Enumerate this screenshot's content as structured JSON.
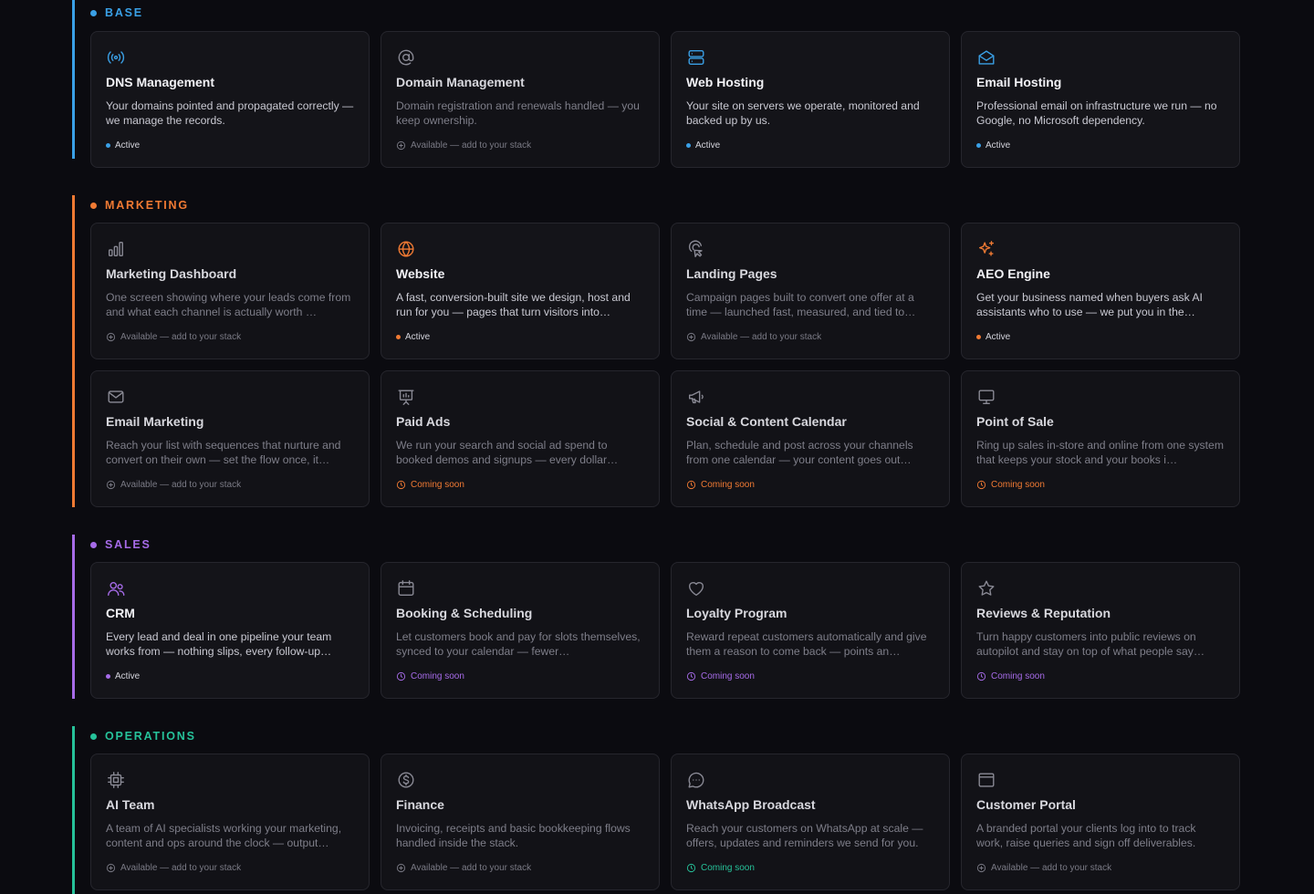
{
  "colors": {
    "base": "#3aa0e6",
    "marketing": "#f07a33",
    "sales": "#a66be8",
    "operations": "#26c29a",
    "icon_muted": "#8a8a95"
  },
  "sections": [
    {
      "key": "base",
      "title": "BASE",
      "cards": [
        {
          "icon": "broadcast-icon",
          "title": "DNS Management",
          "desc": "Your domains pointed and propagated correctly — we manage the records.",
          "status": "active",
          "status_label": "Active"
        },
        {
          "icon": "at-sign-icon",
          "title": "Domain Management",
          "desc": "Domain registration and renewals handled — you keep ownership.",
          "status": "available",
          "status_label": "Available — add to your stack"
        },
        {
          "icon": "server-icon",
          "title": "Web Hosting",
          "desc": "Your site on servers we operate, monitored and backed up by us.",
          "status": "active",
          "status_label": "Active"
        },
        {
          "icon": "mail-open-icon",
          "title": "Email Hosting",
          "desc": "Professional email on infrastructure we run — no Google, no Microsoft dependency.",
          "status": "active",
          "status_label": "Active"
        }
      ]
    },
    {
      "key": "marketing",
      "title": "MARKETING",
      "cards": [
        {
          "icon": "bar-chart-icon",
          "title": "Marketing Dashboard",
          "desc": "One screen showing where your leads come from and what each channel is actually worth …",
          "status": "available",
          "status_label": "Available — add to your stack"
        },
        {
          "icon": "globe-icon",
          "title": "Website",
          "desc": "A fast, conversion-built site we design, host and run for you — pages that turn visitors into…",
          "status": "active",
          "status_label": "Active"
        },
        {
          "icon": "pointer-icon",
          "title": "Landing Pages",
          "desc": "Campaign pages built to convert one offer at a time — launched fast, measured, and tied to…",
          "status": "available",
          "status_label": "Available — add to your stack"
        },
        {
          "icon": "sparkles-icon",
          "title": "AEO Engine",
          "desc": "Get your business named when buyers ask AI assistants who to use — we put you in the…",
          "status": "active",
          "status_label": "Active"
        },
        {
          "icon": "mail-icon",
          "title": "Email Marketing",
          "desc": "Reach your list with sequences that nurture and convert on their own — set the flow once, it…",
          "status": "available",
          "status_label": "Available — add to your stack"
        },
        {
          "icon": "presentation-icon",
          "title": "Paid Ads",
          "desc": "We run your search and social ad spend to booked demos and signups — every dollar…",
          "status": "soon",
          "status_label": "Coming soon"
        },
        {
          "icon": "megaphone-icon",
          "title": "Social & Content Calendar",
          "desc": "Plan, schedule and post across your channels from one calendar — your content goes out…",
          "status": "soon",
          "status_label": "Coming soon"
        },
        {
          "icon": "monitor-icon",
          "title": "Point of Sale",
          "desc": "Ring up sales in-store and online from one system that keeps your stock and your books i…",
          "status": "soon",
          "status_label": "Coming soon"
        }
      ]
    },
    {
      "key": "sales",
      "title": "SALES",
      "cards": [
        {
          "icon": "users-icon",
          "title": "CRM",
          "desc": "Every lead and deal in one pipeline your team works from — nothing slips, every follow-up…",
          "status": "active",
          "status_label": "Active"
        },
        {
          "icon": "calendar-icon",
          "title": "Booking & Scheduling",
          "desc": "Let customers book and pay for slots themselves, synced to your calendar — fewer…",
          "status": "soon",
          "status_label": "Coming soon"
        },
        {
          "icon": "heart-icon",
          "title": "Loyalty Program",
          "desc": "Reward repeat customers automatically and give them a reason to come back — points an…",
          "status": "soon",
          "status_label": "Coming soon"
        },
        {
          "icon": "star-icon",
          "title": "Reviews & Reputation",
          "desc": "Turn happy customers into public reviews on autopilot and stay on top of what people say…",
          "status": "soon",
          "status_label": "Coming soon"
        }
      ]
    },
    {
      "key": "operations",
      "title": "OPERATIONS",
      "cards": [
        {
          "icon": "cpu-icon",
          "title": "AI Team",
          "desc": "A team of AI specialists working your marketing, content and ops around the clock — output…",
          "status": "available",
          "status_label": "Available — add to your stack"
        },
        {
          "icon": "dollar-icon",
          "title": "Finance",
          "desc": "Invoicing, receipts and basic bookkeeping flows handled inside the stack.",
          "status": "available",
          "status_label": "Available — add to your stack"
        },
        {
          "icon": "message-circle-icon",
          "title": "WhatsApp Broadcast",
          "desc": "Reach your customers on WhatsApp at scale — offers, updates and reminders we send for you.",
          "status": "soon",
          "status_label": "Coming soon"
        },
        {
          "icon": "browser-window-icon",
          "title": "Customer Portal",
          "desc": "A branded portal your clients log into to track work, raise queries and sign off deliverables.",
          "status": "available",
          "status_label": "Available — add to your stack"
        }
      ]
    }
  ]
}
